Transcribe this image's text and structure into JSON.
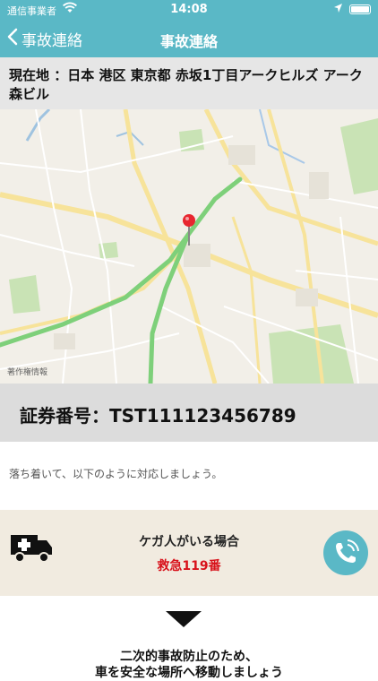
{
  "status_bar": {
    "carrier": "通信事業者",
    "time": "14:08"
  },
  "nav": {
    "back_label": "事故連絡",
    "title": "事故連絡"
  },
  "location": {
    "address": "現在地 ：日本 港区 東京都 赤坂1丁目アークヒルズ アーク森ビル"
  },
  "map": {
    "copyright": "著作権情報"
  },
  "policy": {
    "label": "証券番号：TST111123456789"
  },
  "guidance": {
    "text": "落ち着いて、以下のように対応しましょう。"
  },
  "injury_card": {
    "title": "ケガ人がいる場合",
    "number": "救急119番"
  },
  "instructions": {
    "line1": "二次的事故防止のため、",
    "line2": "車を安全な場所へ移動しましょう"
  },
  "colors": {
    "accent": "#5ab8c6",
    "alert": "#d8121b",
    "card_bg": "#f1ebe0"
  }
}
